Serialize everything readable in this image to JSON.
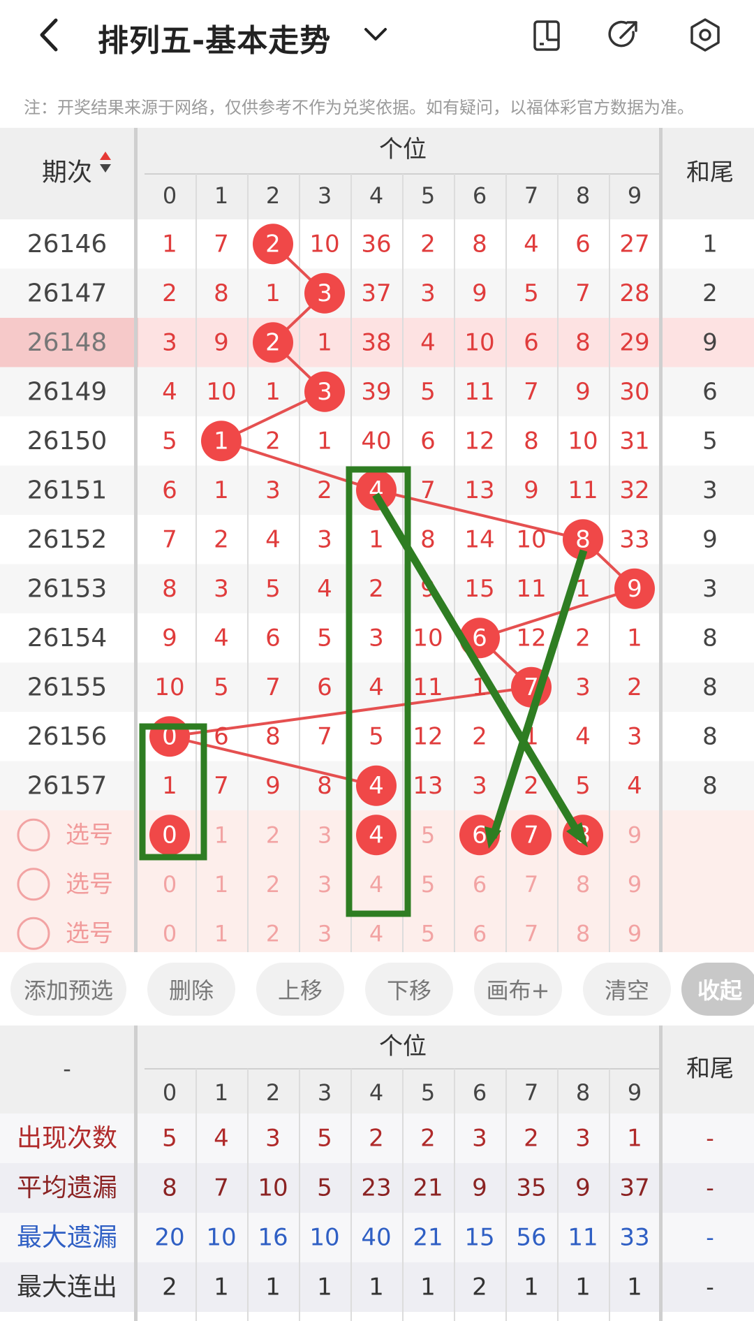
{
  "header": {
    "title": "排列五-基本走势",
    "back_icon": "back-arrow-icon",
    "dropdown_icon": "chevron-down-icon",
    "icons": [
      "phone-layout-icon",
      "share-icon",
      "settings-gear-icon"
    ]
  },
  "note": "注：开奖结果来源于网络，仅供参考不作为兑奖依据。如有疑问，以福体彩官方数据为准。",
  "table": {
    "period_header": "期次",
    "group_header": "个位",
    "tail_header": "和尾",
    "digits": [
      "0",
      "1",
      "2",
      "3",
      "4",
      "5",
      "6",
      "7",
      "8",
      "9"
    ],
    "rows": [
      {
        "period": "26146",
        "cells": [
          1,
          7,
          2,
          10,
          36,
          2,
          8,
          4,
          6,
          27
        ],
        "hit": 2,
        "tail": "1"
      },
      {
        "period": "26147",
        "cells": [
          2,
          8,
          1,
          3,
          37,
          3,
          9,
          5,
          7,
          28
        ],
        "hit": 3,
        "tail": "2"
      },
      {
        "period": "26148",
        "cells": [
          3,
          9,
          2,
          1,
          38,
          4,
          10,
          6,
          8,
          29
        ],
        "hit": 2,
        "tail": "9"
      },
      {
        "period": "26149",
        "cells": [
          4,
          10,
          1,
          3,
          39,
          5,
          11,
          7,
          9,
          30
        ],
        "hit": 3,
        "tail": "6"
      },
      {
        "period": "26150",
        "cells": [
          5,
          1,
          2,
          1,
          40,
          6,
          12,
          8,
          10,
          31
        ],
        "hit": 1,
        "tail": "5"
      },
      {
        "period": "26151",
        "cells": [
          6,
          1,
          3,
          2,
          4,
          7,
          13,
          9,
          11,
          32
        ],
        "hit": 4,
        "tail": "3"
      },
      {
        "period": "26152",
        "cells": [
          7,
          2,
          4,
          3,
          1,
          8,
          14,
          10,
          8,
          33
        ],
        "hit": 8,
        "tail": "9"
      },
      {
        "period": "26153",
        "cells": [
          8,
          3,
          5,
          4,
          2,
          9,
          15,
          11,
          1,
          9
        ],
        "hit": 9,
        "tail": "3"
      },
      {
        "period": "26154",
        "cells": [
          9,
          4,
          6,
          5,
          3,
          10,
          6,
          12,
          2,
          1
        ],
        "hit": 6,
        "tail": "8"
      },
      {
        "period": "26155",
        "cells": [
          10,
          5,
          7,
          6,
          4,
          11,
          1,
          7,
          3,
          2
        ],
        "hit": 7,
        "tail": "8"
      },
      {
        "period": "26156",
        "cells": [
          0,
          6,
          8,
          7,
          5,
          12,
          2,
          1,
          4,
          3
        ],
        "hit": 0,
        "tail": "8"
      },
      {
        "period": "26157",
        "cells": [
          1,
          7,
          9,
          8,
          4,
          13,
          3,
          2,
          5,
          4
        ],
        "hit": 4,
        "tail": "8"
      }
    ],
    "highlight_row": 2,
    "pick_label": "选号",
    "pick_rows": [
      {
        "selected": [
          0,
          4,
          6,
          7,
          8
        ]
      },
      {
        "selected": []
      },
      {
        "selected": []
      }
    ]
  },
  "toolbar": [
    "添加预选",
    "删除",
    "上移",
    "下移",
    "画布+",
    "清空",
    "收起"
  ],
  "stats": {
    "corner": "-",
    "group_header": "个位",
    "tail_header": "和尾",
    "rows": [
      {
        "label": "出现次数",
        "values": [
          5,
          4,
          3,
          5,
          2,
          2,
          3,
          2,
          3,
          1
        ],
        "tail": "-",
        "color": "#b02a2a"
      },
      {
        "label": "平均遗漏",
        "values": [
          8,
          7,
          10,
          5,
          23,
          21,
          9,
          35,
          9,
          37
        ],
        "tail": "-",
        "color": "#8b2323"
      },
      {
        "label": "最大遗漏",
        "values": [
          20,
          10,
          16,
          10,
          40,
          21,
          15,
          56,
          11,
          33
        ],
        "tail": "-",
        "color": "#2f5fc4"
      },
      {
        "label": "最大连出",
        "values": [
          2,
          1,
          1,
          1,
          1,
          1,
          2,
          1,
          1,
          1
        ],
        "tail": "-",
        "color": "#333333"
      }
    ]
  },
  "colors": {
    "red": "#f04848",
    "line": "#e55050",
    "green": "#2e7d22",
    "header_bg": "#efefef",
    "pick_bg": "#fdeeeb"
  }
}
